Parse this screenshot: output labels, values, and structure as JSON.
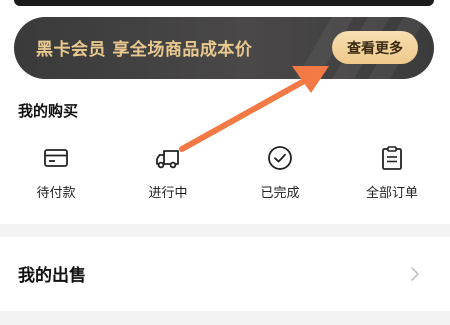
{
  "vip_banner": {
    "text": "黑卡会员 享全场商品成本价",
    "button_label": "查看更多"
  },
  "my_purchases": {
    "title": "我的购买",
    "items": [
      {
        "label": "待付款",
        "icon": "card-icon"
      },
      {
        "label": "进行中",
        "icon": "truck-icon"
      },
      {
        "label": "已完成",
        "icon": "check-circle-icon"
      },
      {
        "label": "全部订单",
        "icon": "clipboard-icon"
      }
    ]
  },
  "my_sales": {
    "title": "我的出售",
    "icon": "chevron-right-icon"
  },
  "colors": {
    "banner_bg": "#3a3a3a",
    "banner_text": "#e9c990",
    "banner_button": "#f3d4a0",
    "annotation_arrow": "#f47a45"
  }
}
